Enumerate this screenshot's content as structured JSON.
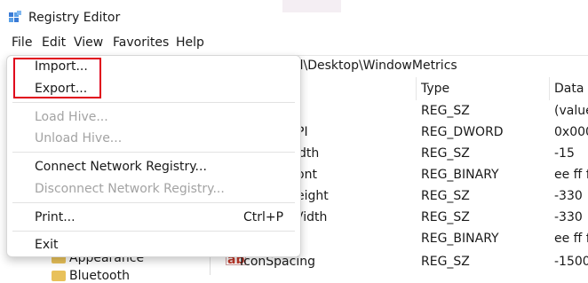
{
  "window": {
    "title": "Registry Editor",
    "icon": "registry-editor-icon"
  },
  "menubar": {
    "file": "File",
    "edit": "Edit",
    "view": "View",
    "favorites": "Favorites",
    "help": "Help"
  },
  "address": {
    "path_visible": "el\\Desktop\\WindowMetrics"
  },
  "tree": {
    "items": [
      {
        "label": "Appearance"
      },
      {
        "label": "Bluetooth"
      }
    ]
  },
  "values": {
    "columns": {
      "type": "Type",
      "data": "Data"
    },
    "rows": [
      {
        "name": "",
        "type": "REG_SZ",
        "data": "(value"
      },
      {
        "name": "PI",
        "type": "REG_DWORD",
        "data": "0x000"
      },
      {
        "name": "dth",
        "type": "REG_SZ",
        "data": "-15"
      },
      {
        "name": "ont",
        "type": "REG_BINARY",
        "data": "ee ff f"
      },
      {
        "name": "eight",
        "type": "REG_SZ",
        "data": "-330"
      },
      {
        "name": "Vidth",
        "type": "REG_SZ",
        "data": "-330"
      },
      {
        "name": "",
        "type": "REG_BINARY",
        "data": "ee ff f"
      },
      {
        "name": "IconSpacing",
        "type": "REG_SZ",
        "data": "-1500"
      }
    ]
  },
  "file_menu": {
    "import": "Import...",
    "export": "Export...",
    "load_hive": "Load Hive...",
    "unload_hive": "Unload Hive...",
    "connect_network_registry": "Connect Network Registry...",
    "disconnect_network_registry": "Disconnect Network Registry...",
    "print": "Print...",
    "print_shortcut": "Ctrl+P",
    "exit": "Exit"
  },
  "colors": {
    "highlight_border": "#e0001b",
    "folder": "#e8c15a",
    "disabled_text": "#a3a3a3"
  }
}
